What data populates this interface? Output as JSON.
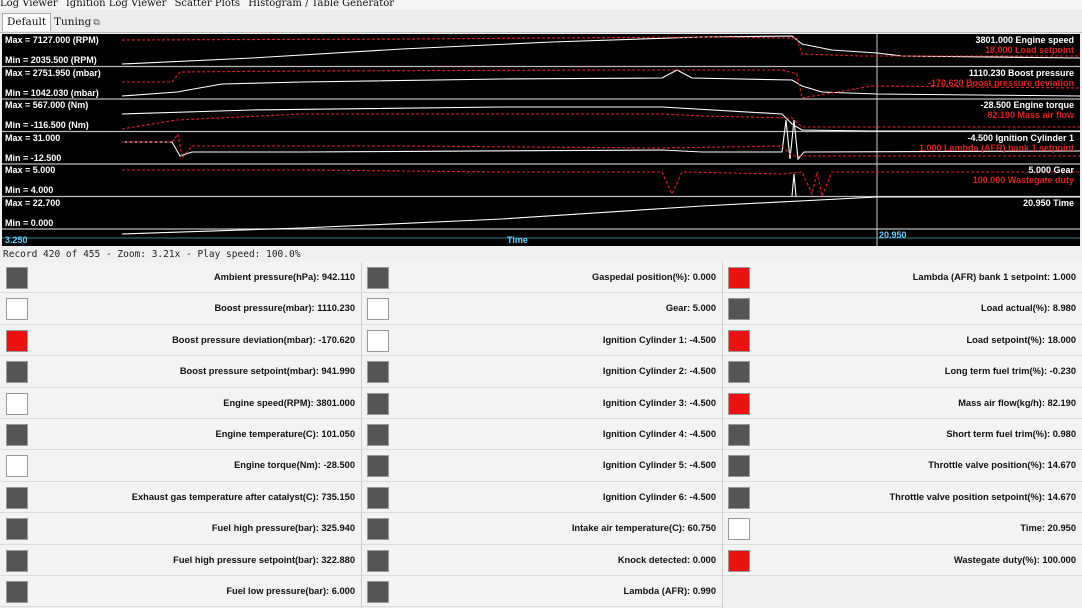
{
  "menu": [
    "Log Viewer",
    "Ignition Log Viewer",
    "Scatter Plots",
    "Histogram / Table Generator"
  ],
  "tabs": [
    {
      "label": "Default",
      "active": true
    },
    {
      "label": "Tuning",
      "icon": "pin-icon"
    }
  ],
  "plot": {
    "rows": [
      {
        "max": "Max = 7127.000 (RPM)",
        "min": "Min = 2035.500 (RPM)",
        "white_name": "3801.000 Engine speed",
        "red_name": "18.000 Load setpoint"
      },
      {
        "max": "Max = 2751.950 (mbar)",
        "min": "Min = 1042.030 (mbar)",
        "white_name": "1110.230 Boost pressure",
        "red_name": "-170.620 Boost pressure deviation"
      },
      {
        "max": "Max = 567.000 (Nm)",
        "min": "Min = -116.500 (Nm)",
        "white_name": "-28.500 Engine torque",
        "red_name": "82.190 Mass air flow"
      },
      {
        "max": "Max = 31.000",
        "min": "Min = -12.500",
        "white_name": "-4.500 Ignition Cylinder 1",
        "red_name": "1.000 Lambda (AFR) bank 1 setpoint"
      },
      {
        "max": "Max = 5.000",
        "min": "Min = 4.000",
        "white_name": "5.000 Gear",
        "red_name": "100.000 Wastegate duty"
      },
      {
        "max": "Max = 22.700",
        "min": "Min = 0.000",
        "white_name": "20.950 Time",
        "red_name": ""
      }
    ],
    "x_start": "3.250",
    "x_label": "Time",
    "x_cursor": "20.950"
  },
  "status": "Record 420 of 455 - Zoom: 3.21x - Play speed: 100.0%",
  "colors": {
    "red": "#ee1111",
    "gray": "#555555",
    "white": "#ffffff"
  },
  "channels": [
    [
      {
        "label": "Ambient pressure(hPa): 942.110",
        "color": "gray"
      },
      {
        "label": "Boost pressure(mbar): 1110.230",
        "color": "white"
      },
      {
        "label": "Boost pressure deviation(mbar): -170.620",
        "color": "red"
      },
      {
        "label": "Boost pressure setpoint(mbar): 941.990",
        "color": "gray"
      },
      {
        "label": "Engine speed(RPM): 3801.000",
        "color": "white"
      },
      {
        "label": "Engine temperature(C): 101.050",
        "color": "gray"
      },
      {
        "label": "Engine torque(Nm): -28.500",
        "color": "white"
      },
      {
        "label": "Exhaust gas temperature after catalyst(C): 735.150",
        "color": "gray"
      },
      {
        "label": "Fuel high pressure(bar): 325.940",
        "color": "gray"
      },
      {
        "label": "Fuel high pressure setpoint(bar): 322.880",
        "color": "gray"
      },
      {
        "label": "Fuel low pressure(bar): 6.000",
        "color": "gray"
      }
    ],
    [
      {
        "label": "Gaspedal position(%): 0.000",
        "color": "gray"
      },
      {
        "label": "Gear: 5.000",
        "color": "white"
      },
      {
        "label": "Ignition Cylinder 1: -4.500",
        "color": "white"
      },
      {
        "label": "Ignition Cylinder 2: -4.500",
        "color": "gray"
      },
      {
        "label": "Ignition Cylinder 3: -4.500",
        "color": "gray"
      },
      {
        "label": "Ignition Cylinder 4: -4.500",
        "color": "gray"
      },
      {
        "label": "Ignition Cylinder 5: -4.500",
        "color": "gray"
      },
      {
        "label": "Ignition Cylinder 6: -4.500",
        "color": "gray"
      },
      {
        "label": "Intake air temperature(C): 60.750",
        "color": "gray"
      },
      {
        "label": "Knock detected: 0.000",
        "color": "gray"
      },
      {
        "label": "Lambda (AFR): 0.990",
        "color": "gray"
      }
    ],
    [
      {
        "label": "Lambda (AFR) bank 1 setpoint: 1.000",
        "color": "red"
      },
      {
        "label": "Load actual(%): 8.980",
        "color": "gray"
      },
      {
        "label": "Load setpoint(%): 18.000",
        "color": "red"
      },
      {
        "label": "Long term fuel trim(%): -0.230",
        "color": "gray"
      },
      {
        "label": "Mass air flow(kg/h): 82.190",
        "color": "red"
      },
      {
        "label": "Short term fuel trim(%): 0.980",
        "color": "gray"
      },
      {
        "label": "Throttle valve position(%): 14.670",
        "color": "gray"
      },
      {
        "label": "Throttle valve position setpoint(%): 14.670",
        "color": "gray"
      },
      {
        "label": "Time: 20.950",
        "color": "white"
      },
      {
        "label": "Wastegate duty(%): 100.000",
        "color": "red"
      }
    ]
  ]
}
